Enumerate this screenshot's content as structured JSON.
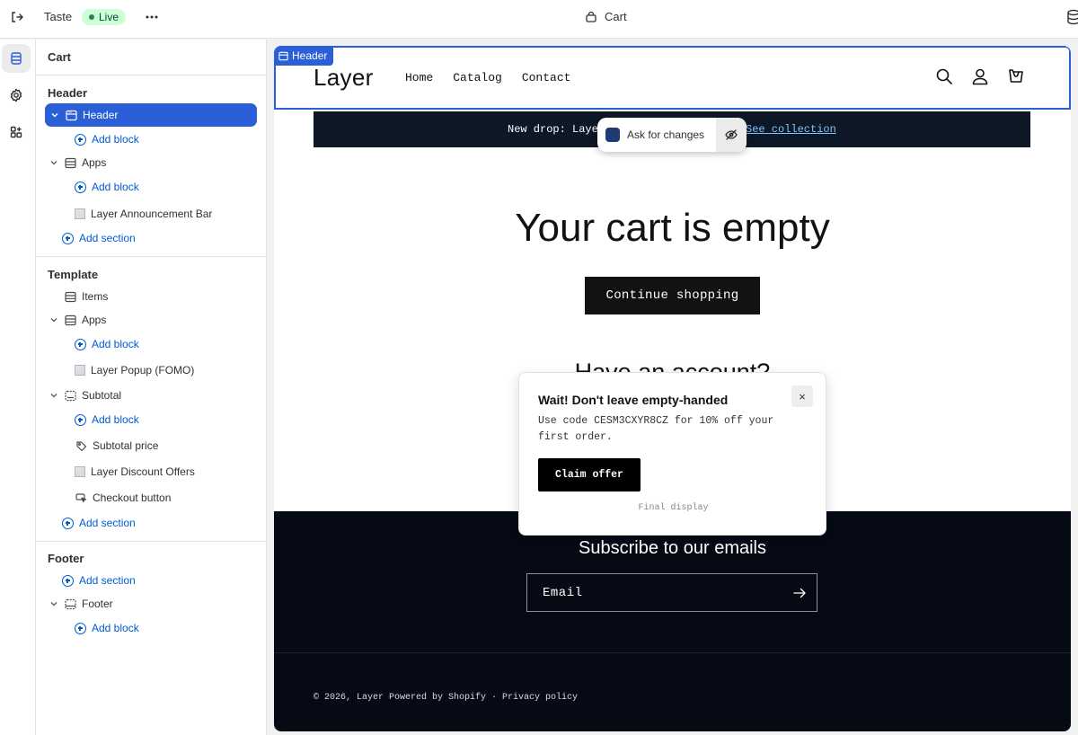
{
  "topbar": {
    "theme_name": "Taste",
    "status": "Live",
    "page_title": "Cart",
    "icons": [
      "exit-icon",
      "more-icon",
      "bag-icon",
      "database-icon"
    ]
  },
  "rail": {
    "icons": [
      "sections-icon",
      "settings-icon",
      "apps-icon"
    ]
  },
  "sidebar": {
    "title": "Cart",
    "header_group": {
      "label": "Header",
      "items": {
        "header": "Header",
        "add_block_1": "Add block",
        "apps": "Apps",
        "add_block_2": "Add block",
        "announcement": "Layer Announcement Bar",
        "add_section": "Add section"
      }
    },
    "template_group": {
      "label": "Template",
      "items": {
        "items": "Items",
        "apps": "Apps",
        "add_block_1": "Add block",
        "popup": "Layer Popup (FOMO)",
        "subtotal": "Subtotal",
        "add_block_2": "Add block",
        "subtotal_price": "Subtotal price",
        "discount_offers": "Layer Discount Offers",
        "checkout_button": "Checkout button",
        "add_section": "Add section"
      }
    },
    "footer_group": {
      "label": "Footer",
      "items": {
        "add_section": "Add section",
        "footer": "Footer",
        "add_block": "Add block"
      }
    }
  },
  "preview": {
    "header_tag": "Header",
    "store": {
      "logo": "Layer",
      "nav": [
        "Home",
        "Catalog",
        "Contact"
      ],
      "header_icons": [
        "search-icon",
        "account-icon",
        "cart-icon"
      ]
    },
    "announcement": {
      "text": "New drop: Laye",
      "link": "See collection"
    },
    "ask_changes": "Ask for changes",
    "cart": {
      "empty_title": "Your cart is empty",
      "continue_button": "Continue shopping",
      "account_heading": "Have an account?"
    },
    "footer": {
      "subscribe_title": "Subscribe to our emails",
      "email_placeholder": "Email",
      "copyright": "© 2026, Layer Powered by Shopify · Privacy policy"
    },
    "popup": {
      "title": "Wait! Don't leave empty-handed",
      "body": "Use code CESM3CXYR8CZ for 10% off your first order.",
      "button": "Claim offer",
      "close": "×",
      "footnote": "Final display"
    }
  },
  "colors": {
    "accent": "#2a5fd8",
    "link_blue": "#005bd3",
    "live_bg": "#cdfed4",
    "footer_bg": "#050a14"
  }
}
